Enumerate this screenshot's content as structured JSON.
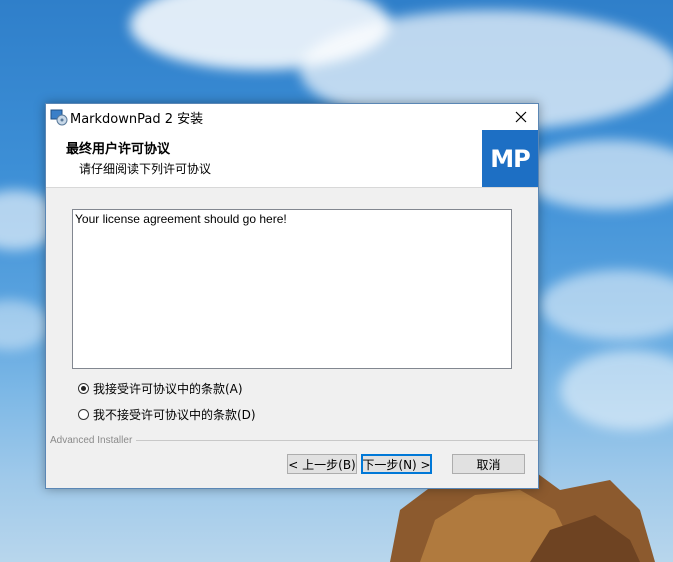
{
  "window": {
    "title": "MarkdownPad 2 安装",
    "close_symbol": "✕"
  },
  "header": {
    "title": "最终用户许可协议",
    "subtitle": "请仔细阅读下列许可协议",
    "logo_text": "MP"
  },
  "license": {
    "text": "Your license agreement should go here!"
  },
  "options": [
    {
      "label": "我接受许可协议中的条款(A)",
      "selected": true
    },
    {
      "label": "我不接受许可协议中的条款(D)",
      "selected": false
    }
  ],
  "footer": {
    "brand": "Advanced Installer"
  },
  "buttons": {
    "back": "< 上一步(B)",
    "next": "下一步(N) >",
    "cancel": "取消"
  },
  "colors": {
    "accent": "#1d6fc4",
    "focus_border": "#0078d7"
  }
}
